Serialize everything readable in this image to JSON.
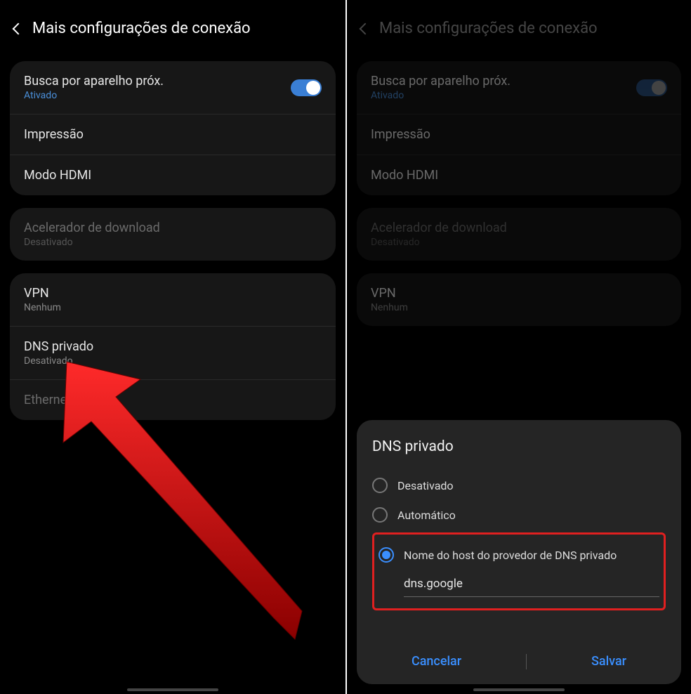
{
  "left": {
    "header_title": "Mais configurações de conexão",
    "card1": {
      "row1": {
        "title": "Busca por aparelho próx.",
        "sub": "Ativado"
      },
      "row2": {
        "title": "Impressão"
      },
      "row3": {
        "title": "Modo HDMI"
      }
    },
    "card2": {
      "row1": {
        "title": "Acelerador de download",
        "sub": "Desativado"
      }
    },
    "card3": {
      "row1": {
        "title": "VPN",
        "sub": "Nenhum"
      },
      "row2": {
        "title": "DNS privado",
        "sub": "Desativado"
      },
      "row3": {
        "title": "Ethernet"
      }
    }
  },
  "right": {
    "header_title": "Mais configurações de conexão",
    "card1": {
      "row1": {
        "title": "Busca por aparelho próx.",
        "sub": "Ativado"
      },
      "row2": {
        "title": "Impressão"
      },
      "row3": {
        "title": "Modo HDMI"
      }
    },
    "card2": {
      "row1": {
        "title": "Acelerador de download",
        "sub": "Desativado"
      }
    },
    "card3": {
      "row1": {
        "title": "VPN",
        "sub": "Nenhum"
      }
    },
    "dialog": {
      "title": "DNS privado",
      "option1": "Desativado",
      "option2": "Automático",
      "option3": "Nome do host do provedor de DNS privado",
      "hostname": "dns.google",
      "cancel": "Cancelar",
      "save": "Salvar"
    }
  }
}
